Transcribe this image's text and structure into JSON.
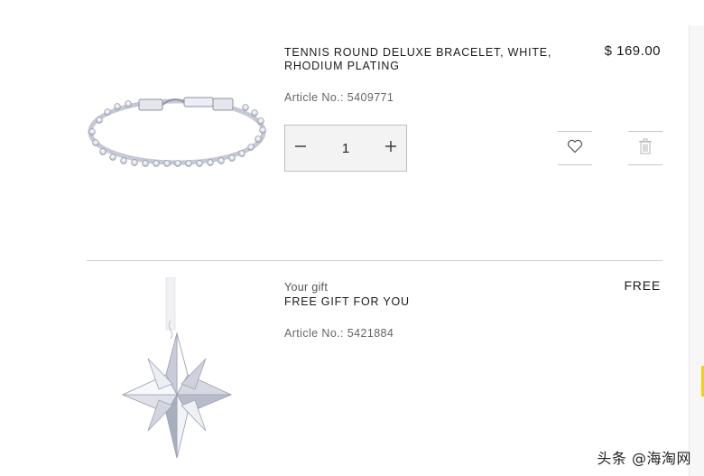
{
  "items": [
    {
      "title": "TENNIS ROUND DELUXE BRACELET, WHITE, RHODIUM PLATING",
      "article": "Article No.: 5409771",
      "price": "$ 169.00",
      "quantity": "1",
      "image": "bracelet-image"
    },
    {
      "subtitle": "Your gift",
      "title": "FREE GIFT FOR YOU",
      "article": "Article No.: 5421884",
      "price": "FREE",
      "image": "star-ornament-image"
    }
  ],
  "icons": {
    "minus": "minus-icon",
    "plus": "plus-icon",
    "wishlist": "heart-icon",
    "remove": "trash-icon"
  },
  "colors": {
    "accent": "#f5cf11",
    "divider": "#cfcfcf"
  },
  "watermark": "头条 @海淘网"
}
